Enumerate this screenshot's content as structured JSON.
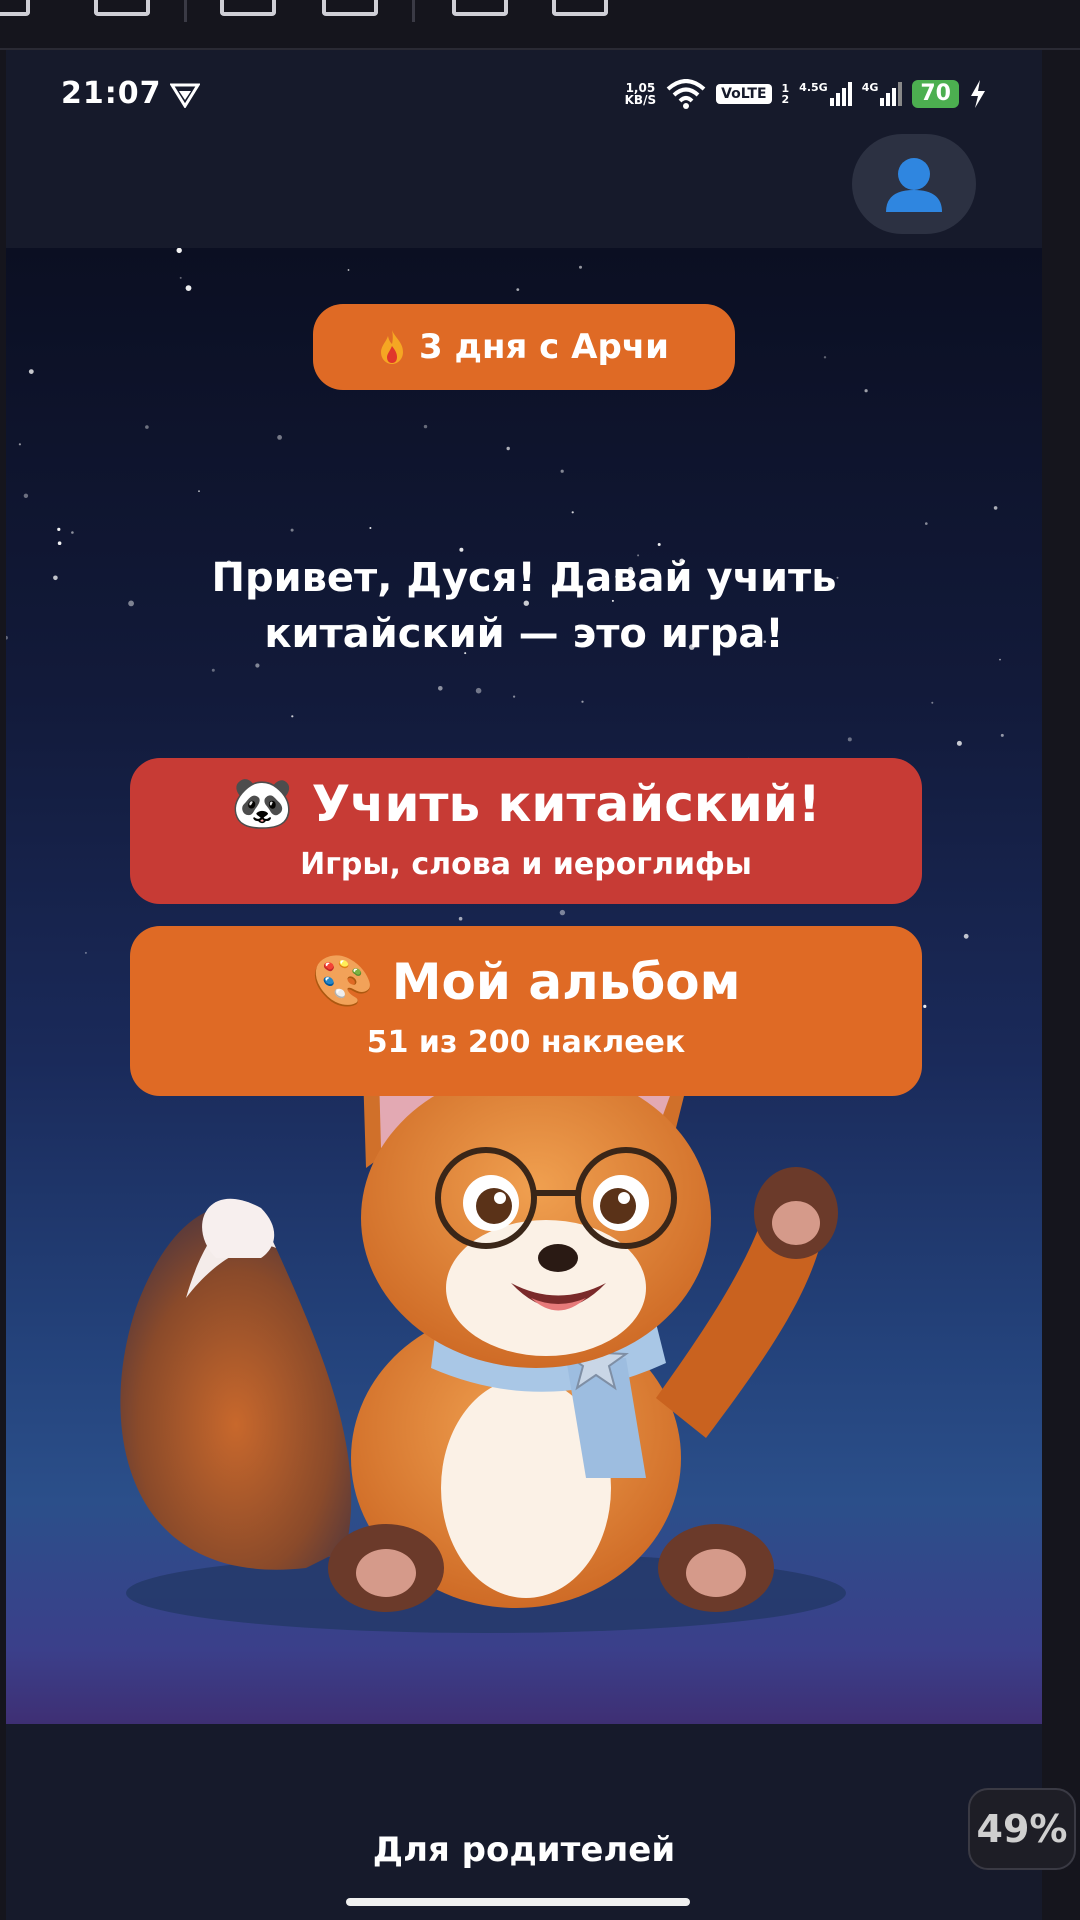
{
  "status_bar": {
    "time": "21:07",
    "net_speed_value": "1,05",
    "net_speed_unit": "KB/S",
    "volte": "VoLTE",
    "sim_label_1": "1",
    "sim_label_2": "2",
    "signal_1": "4.5G",
    "signal_2": "4G",
    "battery": "70"
  },
  "header": {
    "profile_icon": "user-icon"
  },
  "streak": {
    "icon": "fire-icon",
    "text": "3 дня с Арчи"
  },
  "greeting": {
    "line1": "Привет, Дуся! Давай учить",
    "line2": "китайский — это игра!"
  },
  "learn_card": {
    "emoji": "🐼",
    "title": "Учить китайский!",
    "subtitle": "Игры, слова и иероглифы"
  },
  "album_card": {
    "emoji": "🎨",
    "title": "Мой альбом",
    "subtitle": "51 из 200 наклеек"
  },
  "footer": {
    "parents_link": "Для родителей"
  },
  "zoom": {
    "level": "49%"
  },
  "colors": {
    "streak": "#df6a25",
    "learn": "#c73b35",
    "album": "#df6a25",
    "battery": "#4caf50"
  }
}
